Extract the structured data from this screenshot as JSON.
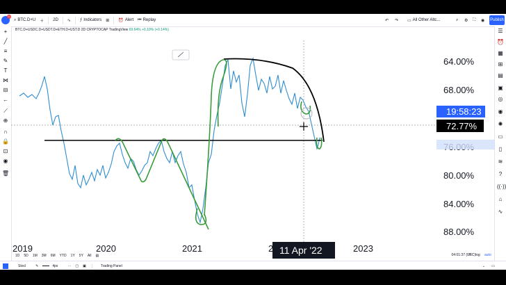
{
  "toolbar": {
    "logo_badge": "11",
    "symbol_search": "BTC.D+U",
    "interval": "2D",
    "indicators_label": "Indicators",
    "alert_label": "Alert",
    "replay_label": "Replay",
    "layout_label": "All Other Altc...",
    "publish_label": "Publish"
  },
  "legend": {
    "symbol": "BTC.D+USDC.D+USDT.D+ETH.D+UST.D",
    "interval": "2D",
    "exchange": "CRYPTOCAP",
    "source": "TradingView",
    "value": "69.64%",
    "change": "+0.10% (+0.14%)"
  },
  "price_axis": {
    "ticks": [
      "64.00%",
      "68.00%",
      "72.77%",
      "76.00%",
      "80.00%",
      "84.00%",
      "88.00%"
    ],
    "countdown": "19:58:23",
    "current_value": "72.77%"
  },
  "time_axis": {
    "ticks": [
      "2019",
      "2020",
      "2021",
      "2022",
      "2023"
    ],
    "crosshair_date": "11 Apr '22"
  },
  "range_bar": {
    "ranges": [
      "1D",
      "5D",
      "1M",
      "3M",
      "6M",
      "YTD",
      "1Y",
      "5Y",
      "All"
    ],
    "clock": "04:01:37 (UTC)",
    "percent_label": "%",
    "log_label": "log",
    "auto_label": "auto"
  },
  "bottom_panel": {
    "stock_label": "Stocl",
    "width_label": "4px",
    "panel_label": "Trading Panel"
  },
  "colors": {
    "price_line": "#2e8dd1",
    "drawing_green": "#3a9b3a",
    "drawing_black": "#000000",
    "accent_blue": "#2962ff"
  },
  "icons": {
    "left": [
      "cursor-icon",
      "trend-line-icon",
      "fib-icon",
      "brush-icon",
      "text-icon",
      "pattern-icon",
      "measure-icon",
      "back-arrow-icon",
      "ruler-icon",
      "zoom-icon",
      "magnet-icon",
      "lock-icon",
      "eye-icon",
      "trash-icon"
    ],
    "right": [
      "watchlist-icon",
      "alerts-icon",
      "data-window-icon",
      "news-icon",
      "calendar-icon",
      "ideas-icon",
      "streams-icon",
      "chat-icon",
      "notifications-icon",
      "hotlist-icon",
      "help-icon",
      "signal-icon",
      "settings-icon"
    ]
  }
}
